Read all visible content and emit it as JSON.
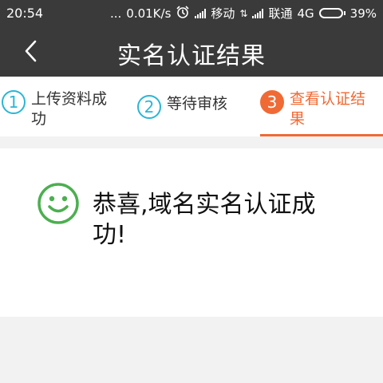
{
  "statusbar": {
    "time": "20:54",
    "dots": "...",
    "speed": "0.01K/s",
    "carrier1": "移动",
    "carrier2": "联通",
    "network": "4G",
    "battery": "39%",
    "battery_level": 0.39
  },
  "navbar": {
    "back_icon": "chevron-left-icon",
    "title": "实名认证结果"
  },
  "steps": [
    {
      "num": "1",
      "label": "上传资料成功",
      "active": false
    },
    {
      "num": "2",
      "label": "等待审核",
      "active": false
    },
    {
      "num": "3",
      "label": "查看认证结果",
      "active": true
    }
  ],
  "result": {
    "icon": "smile-icon",
    "message": "恭喜,域名实名认证成功!"
  },
  "colors": {
    "bar": "#3a3a3a",
    "accent": "#f06a35",
    "step": "#2ab6d6",
    "success": "#4caf50"
  }
}
